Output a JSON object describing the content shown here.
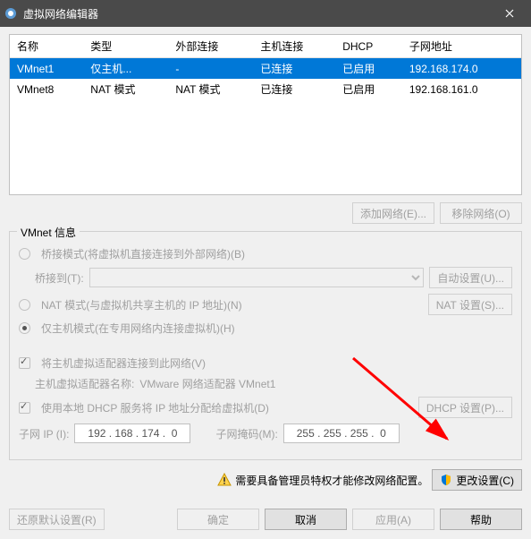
{
  "titlebar": {
    "title": "虚拟网络编辑器"
  },
  "table": {
    "headers": [
      "名称",
      "类型",
      "外部连接",
      "主机连接",
      "DHCP",
      "子网地址"
    ],
    "rows": [
      {
        "name": "VMnet1",
        "type": "仅主机...",
        "ext": "-",
        "host": "已连接",
        "dhcp": "已启用",
        "subnet": "192.168.174.0",
        "selected": true
      },
      {
        "name": "VMnet8",
        "type": "NAT 模式",
        "ext": "NAT 模式",
        "host": "已连接",
        "dhcp": "已启用",
        "subnet": "192.168.161.0",
        "selected": false
      }
    ]
  },
  "buttons": {
    "add_network": "添加网络(E)...",
    "remove_network": "移除网络(O)",
    "auto_settings": "自动设置(U)...",
    "nat_settings": "NAT 设置(S)...",
    "dhcp_settings": "DHCP 设置(P)...",
    "change_settings": "更改设置(C)",
    "restore_defaults": "还原默认设置(R)",
    "ok": "确定",
    "cancel": "取消",
    "apply": "应用(A)",
    "help": "帮助"
  },
  "group": {
    "legend": "VMnet 信息",
    "bridged": "桥接模式(将虚拟机直接连接到外部网络)(B)",
    "bridge_to": "桥接到(T):",
    "nat": "NAT 模式(与虚拟机共享主机的 IP 地址)(N)",
    "hostonly": "仅主机模式(在专用网络内连接虚拟机)(H)",
    "connect_host": "将主机虚拟适配器连接到此网络(V)",
    "adapter_name_label": "主机虚拟适配器名称:",
    "adapter_name_value": "VMware 网络适配器 VMnet1",
    "use_dhcp": "使用本地 DHCP 服务将 IP 地址分配给虚拟机(D)",
    "subnet_ip_label": "子网 IP (I):",
    "subnet_ip_value": "192 . 168 . 174 .  0",
    "subnet_mask_label": "子网掩码(M):",
    "subnet_mask_value": "255 . 255 . 255 .  0"
  },
  "warning": "需要具备管理员特权才能修改网络配置。"
}
